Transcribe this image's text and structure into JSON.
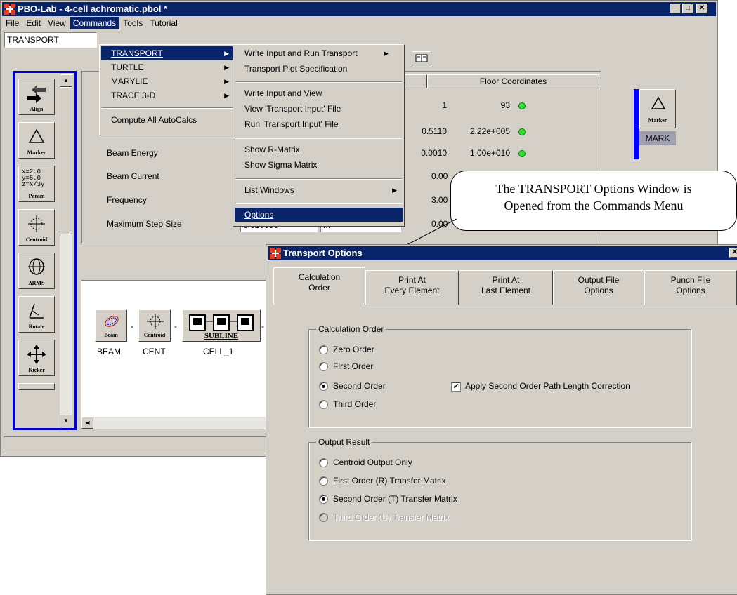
{
  "main_window": {
    "title": "PBO-Lab - 4-cell achromatic.pbol *",
    "menu": [
      "File",
      "Edit",
      "View",
      "Commands",
      "Tools",
      "Tutorial"
    ],
    "toolbar_combo": "TRANSPORT",
    "table_header": "Floor Coordinates",
    "rows": [
      {
        "v1": "1",
        "v2": "93"
      },
      {
        "v1": "0.5110",
        "v2": "2.22e+005"
      },
      {
        "v1": "0.0010",
        "v2": "1.00e+010"
      },
      {
        "v1": "0.00",
        "v2": ""
      },
      {
        "v1": "3.00",
        "v2": ""
      },
      {
        "v1": "0.00",
        "v2": ""
      }
    ],
    "param_labels": [
      "Beam Energy",
      "Beam Current",
      "Frequency",
      "Maximum Step Size"
    ],
    "step_value": "0.010000",
    "step_unit": "m",
    "marker_button": "Marker",
    "mark_label": "MARK",
    "palette": [
      "Align",
      "Marker",
      "Param",
      "Centroid",
      "ΔRMS",
      "Rotate",
      "Kicker"
    ],
    "param_icon_text": [
      "x=2.0",
      "y=5.0",
      "z=x/3y"
    ],
    "beamline": [
      {
        "icon": "Beam",
        "name": "BEAM"
      },
      {
        "icon": "Centroid",
        "name": "CENT"
      },
      {
        "icon": "SUBLINE",
        "name": "CELL_1"
      }
    ]
  },
  "commands_menu": {
    "items": [
      "TRANSPORT",
      "TURTLE",
      "MARYLIE",
      "TRACE 3-D",
      "Compute All AutoCalcs"
    ]
  },
  "transport_submenu": {
    "items": [
      "Write Input and Run Transport",
      "Transport Plot Specification",
      "Write Input and View",
      "View 'Transport Input' File",
      "Run 'Transport Input' File",
      "Show R-Matrix",
      "Show Sigma Matrix",
      "List Windows",
      "Options"
    ]
  },
  "callout": {
    "line1": "The TRANSPORT Options Window is",
    "line2": "Opened from the Commands Menu"
  },
  "options_window": {
    "title": "Transport Options",
    "tabs": [
      {
        "l1": "Calculation",
        "l2": "Order"
      },
      {
        "l1": "Print At",
        "l2": "Every Element"
      },
      {
        "l1": "Print At",
        "l2": "Last Element"
      },
      {
        "l1": "Output File",
        "l2": "Options"
      },
      {
        "l1": "Punch File",
        "l2": "Options"
      }
    ],
    "calc_group_title": "Calculation Order",
    "calc_options": [
      "Zero Order",
      "First Order",
      "Second Order",
      "Third Order"
    ],
    "calc_selected": "Second Order",
    "path_length_checkbox": "Apply Second Order Path Length Correction",
    "path_length_checked": true,
    "output_group_title": "Output Result",
    "output_options": [
      "Centroid Output Only",
      "First Order (R) Transfer Matrix",
      "Second Order (T) Transfer Matrix",
      "Third Order (U) Transfer Matrix"
    ],
    "output_selected": "Second Order (T) Transfer Matrix",
    "output_disabled": "Third Order (U) Transfer Matrix"
  }
}
